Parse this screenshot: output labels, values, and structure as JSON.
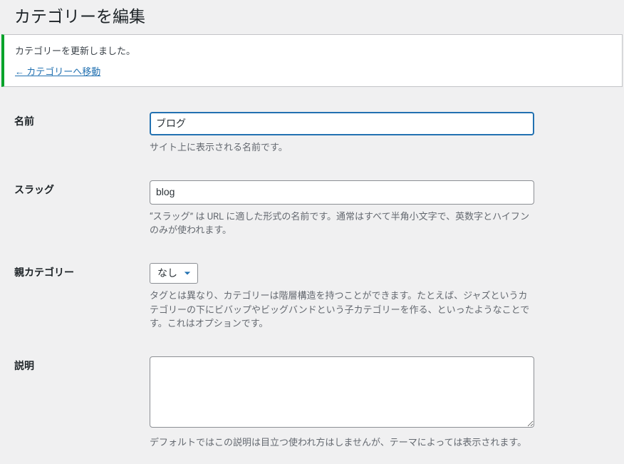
{
  "page_title": "カテゴリーを編集",
  "notice": {
    "message": "カテゴリーを更新しました。",
    "link_text": "← カテゴリーへ移動"
  },
  "form": {
    "name": {
      "label": "名前",
      "value": "ブログ",
      "description": "サイト上に表示される名前です。"
    },
    "slug": {
      "label": "スラッグ",
      "value": "blog",
      "description": "“スラッグ” は URL に適した形式の名前です。通常はすべて半角小文字で、英数字とハイフンのみが使われます。"
    },
    "parent": {
      "label": "親カテゴリー",
      "selected": "なし",
      "description": "タグとは異なり、カテゴリーは階層構造を持つことができます。たとえば、ジャズというカテゴリーの下にビバップやビッグバンドという子カテゴリーを作る、といったようなことです。これはオプションです。"
    },
    "description": {
      "label": "説明",
      "value": "",
      "description": "デフォルトではこの説明は目立つ使われ方はしませんが、テーマによっては表示されます。"
    }
  }
}
